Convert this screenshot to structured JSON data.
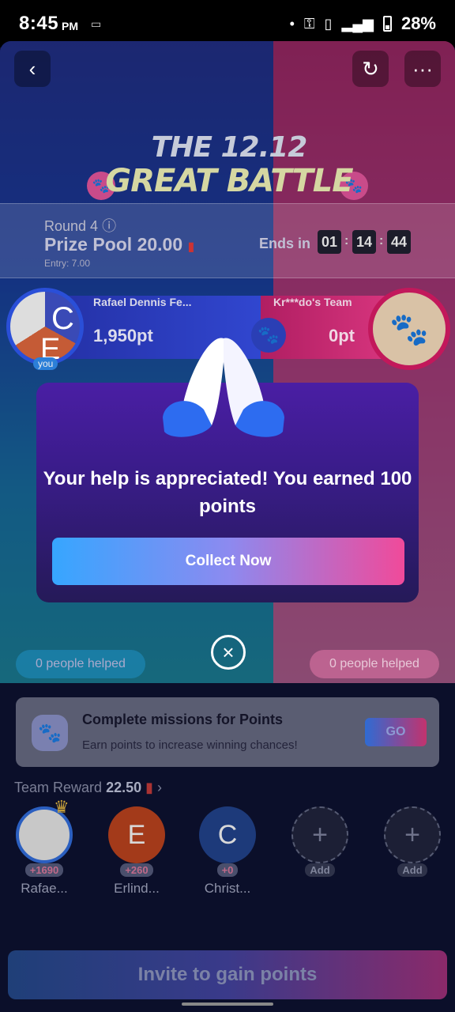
{
  "status_bar": {
    "time": "8:45",
    "ampm": "PM",
    "battery": "28%"
  },
  "battle": {
    "title_line1": "THE 12.12",
    "title_line2": "GREAT BATTLE",
    "round": "Round 4",
    "prize_pool": "Prize Pool 20.00",
    "entry": "Entry: 7.00",
    "ends_in_label": "Ends in",
    "timer": [
      "01",
      "14",
      "44"
    ],
    "left_team": {
      "name": "Rafael Dennis Fe...",
      "points": "1,950pt",
      "avatar_letters": [
        "C",
        "E"
      ],
      "you_label": "you",
      "helped": "0 people helped"
    },
    "right_team": {
      "name": "Kr***do's Team",
      "points": "0pt",
      "helped": "0 people helped"
    }
  },
  "modal": {
    "message": "Your help is appreciated! You earned 100 points",
    "collect_label": "Collect Now"
  },
  "missions": {
    "title": "Complete missions for Points",
    "subtitle": "Earn points to increase winning chances!",
    "go_label": "GO"
  },
  "team_reward": {
    "label": "Team Reward",
    "value": "22.50"
  },
  "members": [
    {
      "name": "Rafae...",
      "badge": "+1690",
      "letter": ""
    },
    {
      "name": "Erlind...",
      "badge": "+260",
      "letter": "E"
    },
    {
      "name": "Christ...",
      "badge": "+0",
      "letter": "C"
    },
    {
      "name": "",
      "badge": "Add",
      "letter": "+"
    },
    {
      "name": "",
      "badge": "Add",
      "letter": "+"
    }
  ],
  "invite_label": "Invite to gain points",
  "colors": {
    "accent_blue": "#36a6ff",
    "accent_pink": "#f04a9a",
    "modal_purple": "#4a1ea4"
  }
}
